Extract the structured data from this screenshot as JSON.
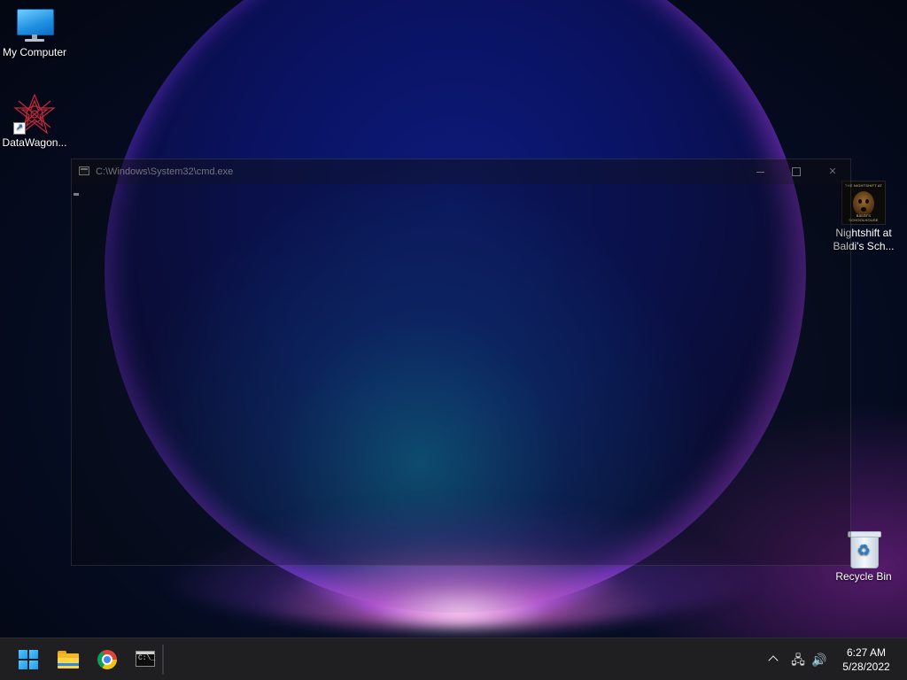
{
  "desktop": {
    "icons": [
      {
        "label": "My Computer",
        "icon": "monitor-icon"
      },
      {
        "label": "DataWagon...",
        "icon": "datawagon-icon"
      },
      {
        "label": "Nightshift at Baldi's Sch...",
        "icon": "game-icon"
      },
      {
        "label": "Recycle Bin",
        "icon": "recycle-bin-icon"
      }
    ],
    "game_icon_text_top": "THE NIGHTSHIFT AT",
    "game_icon_text_bottom": "BALDI'S SCHOOLHOUSE"
  },
  "cmd_window": {
    "title": "C:\\Windows\\System32\\cmd.exe",
    "close_glyph": "✕"
  },
  "taskbar": {
    "apps": [
      {
        "name": "Start",
        "icon": "windows-logo-icon"
      },
      {
        "name": "File Explorer",
        "icon": "folder-icon"
      },
      {
        "name": "Google Chrome",
        "icon": "chrome-icon"
      },
      {
        "name": "Command Prompt",
        "icon": "terminal-icon"
      }
    ],
    "terminal_prompt": "C:\\_",
    "tray": {
      "network_glyph": "🖧",
      "volume_glyph": "🔊",
      "time": "6:27 AM",
      "date": "5/28/2022"
    }
  },
  "colors": {
    "taskbar_bg": "#1f1f22",
    "start_blue": "#1a9ae8",
    "folder_yellow": "#f2b722"
  }
}
